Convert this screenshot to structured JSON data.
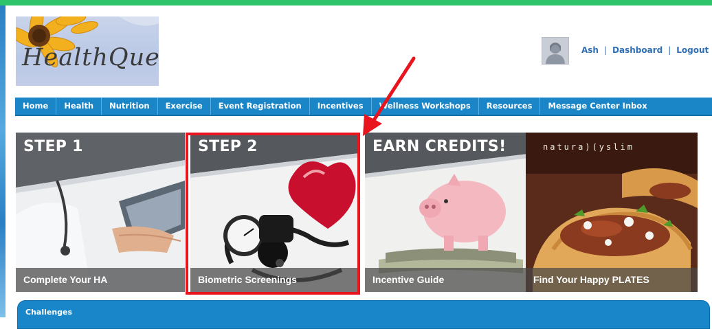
{
  "header": {
    "logo_text": "HealthQuest",
    "user_links": [
      "Ash",
      "Dashboard",
      "Logout"
    ],
    "separator": "|"
  },
  "nav": {
    "items": [
      "Home",
      "Health",
      "Nutrition",
      "Exercise",
      "Event Registration",
      "Incentives",
      "Wellness Workshops",
      "Resources",
      "Message Center Inbox"
    ]
  },
  "banners": [
    {
      "title": "STEP 1",
      "caption": "Complete Your HA"
    },
    {
      "title": "STEP 2",
      "caption": "Biometric Screenings"
    },
    {
      "title": "EARN CREDITS!",
      "caption": "Incentive Guide"
    },
    {
      "brand": "natura)(yslim",
      "caption": "Find Your Happy PLATES"
    }
  ],
  "challenges": {
    "title": "Challenges"
  },
  "colors": {
    "accent_green": "#2ec46a",
    "nav_blue": "#1b86c7",
    "highlight_red": "#e8141e"
  }
}
